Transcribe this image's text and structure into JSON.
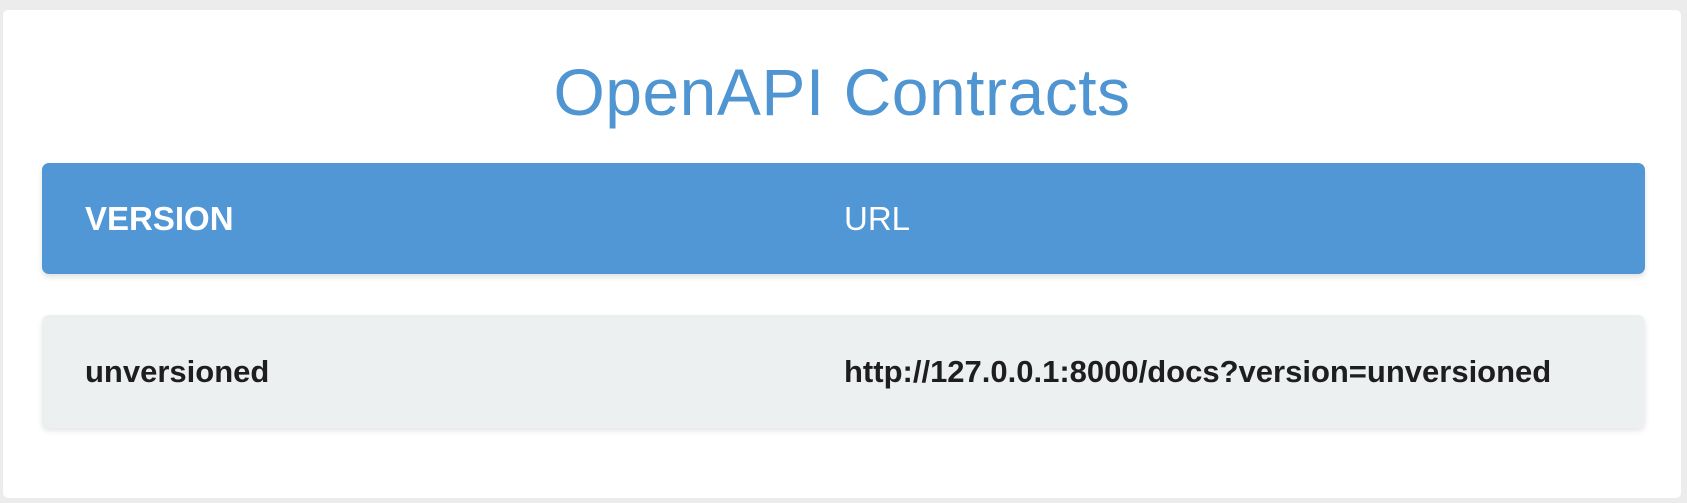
{
  "page": {
    "title": "OpenAPI Contracts"
  },
  "table": {
    "headers": {
      "version": "VERSION",
      "url": "URL"
    },
    "rows": [
      {
        "version": "unversioned",
        "url": "http://127.0.0.1:8000/docs?version=unversioned"
      }
    ]
  },
  "colors": {
    "title": "#4f95d2",
    "header_background": "#5196d5",
    "row_background": "#ecf0f1",
    "page_background": "#ececec"
  }
}
